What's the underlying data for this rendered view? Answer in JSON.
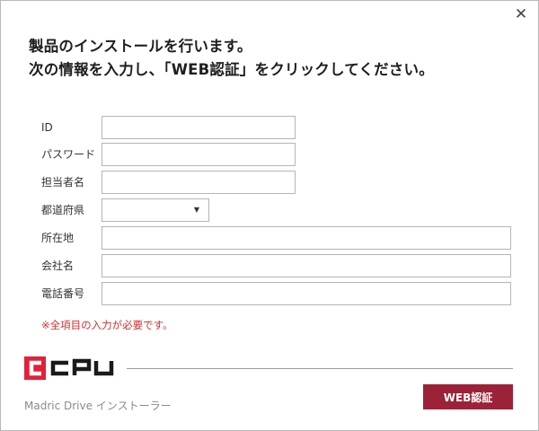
{
  "window": {
    "close_symbol": "✕"
  },
  "heading": {
    "line1": "製品のインストールを行います。",
    "line2": "次の情報を入力し、「WEB認証」をクリックしてください。"
  },
  "form": {
    "id": {
      "label": "ID",
      "value": ""
    },
    "password": {
      "label": "パスワード",
      "value": ""
    },
    "person_name": {
      "label": "担当者名",
      "value": ""
    },
    "prefecture": {
      "label": "都道府県",
      "selected": "",
      "arrow": "▼"
    },
    "address": {
      "label": "所在地",
      "value": ""
    },
    "company": {
      "label": "会社名",
      "value": ""
    },
    "phone": {
      "label": "電話番号",
      "value": ""
    }
  },
  "required_note": "※全項目の入力が必要です。",
  "logo": {
    "brand": "CPU",
    "colors": {
      "red": "#e3203a",
      "dark": "#1a1a1a"
    }
  },
  "footer": {
    "installer_name": "Madric Drive インストーラー",
    "web_auth_label": "WEB認証"
  },
  "colors": {
    "button_bg": "#9b2238",
    "note_red": "#d03030"
  }
}
